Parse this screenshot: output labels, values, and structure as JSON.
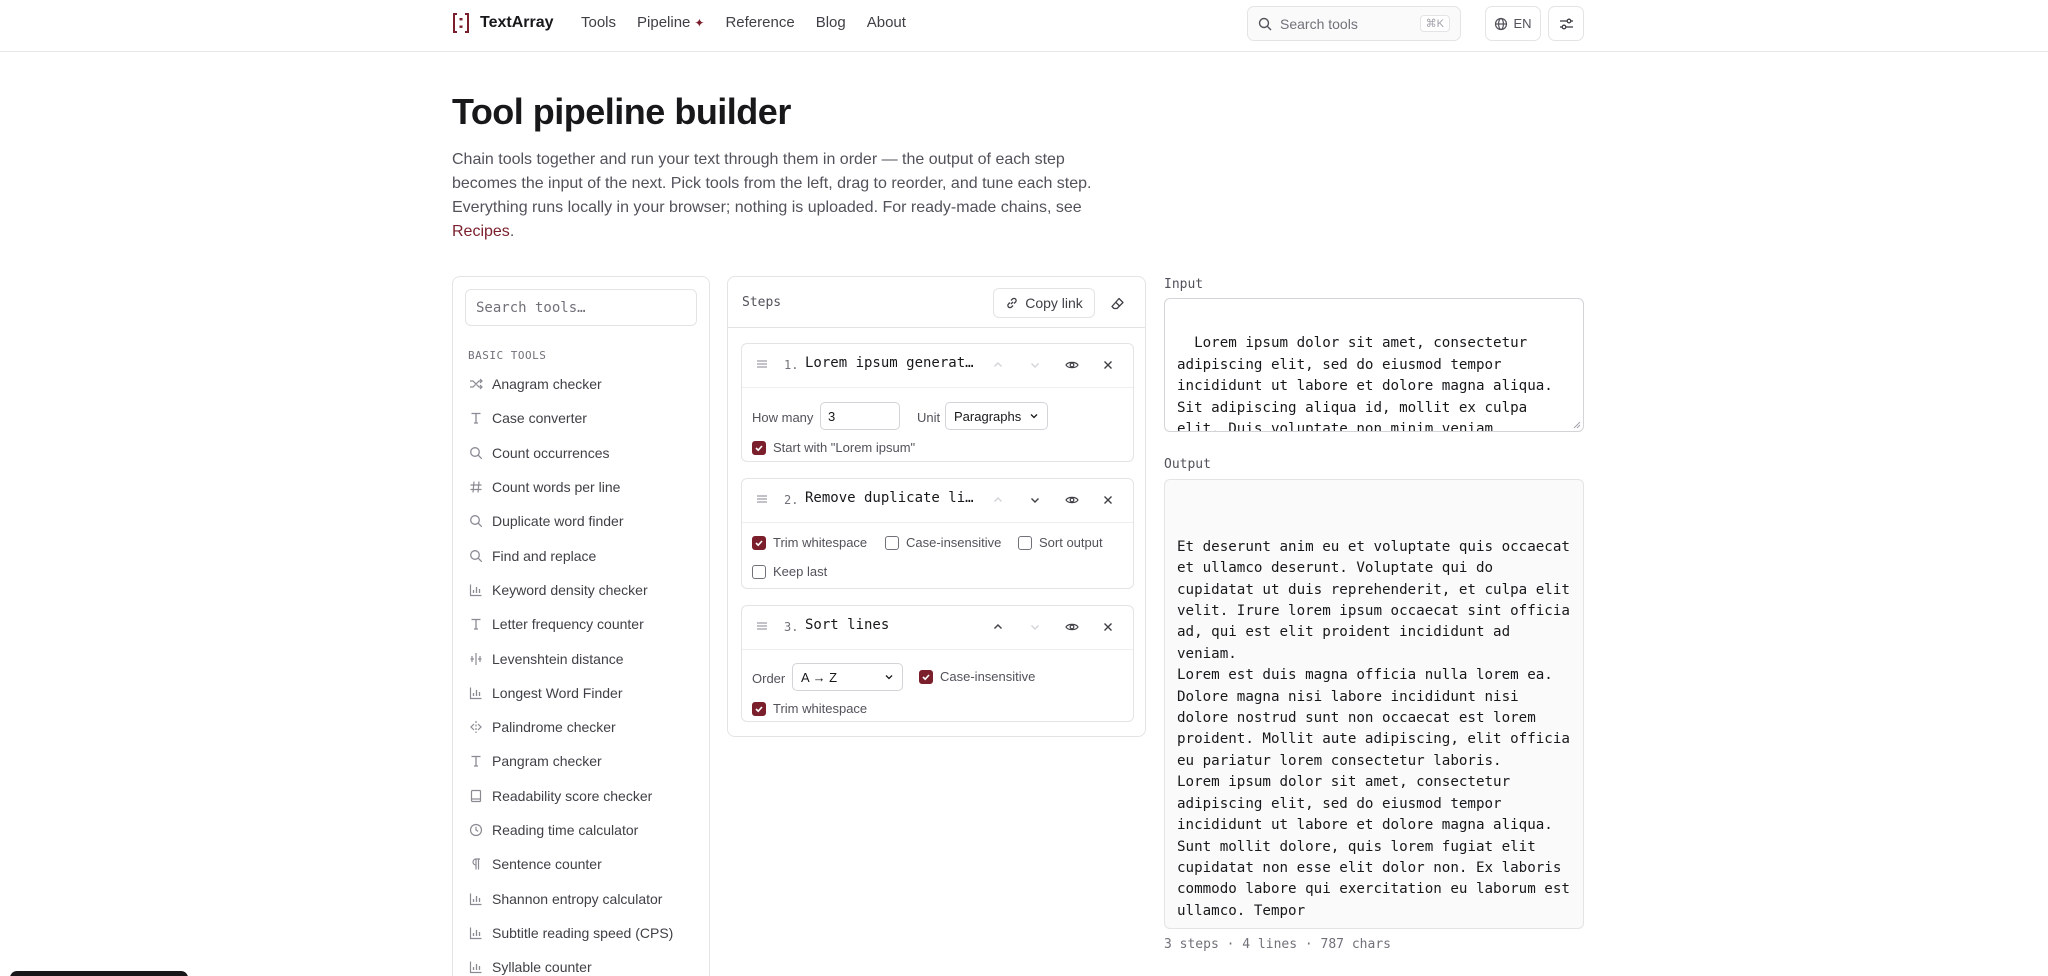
{
  "header": {
    "brand": "TextArray",
    "nav": [
      {
        "label": "Tools"
      },
      {
        "label": "Pipeline"
      },
      {
        "label": "Reference"
      },
      {
        "label": "Blog"
      },
      {
        "label": "About"
      }
    ],
    "search_placeholder": "Search tools",
    "search_shortcut": "⌘K",
    "language": "EN"
  },
  "page": {
    "title": "Tool pipeline builder",
    "intro": "Chain tools together and run your text through them in order — the output of each step becomes the input of the next. Pick tools from the left, drag to reorder, and tune each step. Everything runs locally in your browser; nothing is uploaded. For ready-made chains, see ",
    "intro_link": "Recipes",
    "intro_end": "."
  },
  "tools": {
    "search_placeholder": "Search tools…",
    "group_label": "BASIC TOOLS",
    "items": [
      {
        "label": "Anagram checker",
        "icon": "shuffle-icon"
      },
      {
        "label": "Case converter",
        "icon": "type-icon"
      },
      {
        "label": "Count occurrences",
        "icon": "search-icon"
      },
      {
        "label": "Count words per line",
        "icon": "hash-icon"
      },
      {
        "label": "Duplicate word finder",
        "icon": "search-icon"
      },
      {
        "label": "Find and replace",
        "icon": "search-icon"
      },
      {
        "label": "Keyword density checker",
        "icon": "bar-chart-icon"
      },
      {
        "label": "Letter frequency counter",
        "icon": "type-icon"
      },
      {
        "label": "Levenshtein distance",
        "icon": "diff-icon"
      },
      {
        "label": "Longest Word Finder",
        "icon": "bar-chart-icon"
      },
      {
        "label": "Palindrome checker",
        "icon": "mirror-icon"
      },
      {
        "label": "Pangram checker",
        "icon": "type-icon"
      },
      {
        "label": "Readability score checker",
        "icon": "book-icon"
      },
      {
        "label": "Reading time calculator",
        "icon": "clock-icon"
      },
      {
        "label": "Sentence counter",
        "icon": "pilcrow-icon"
      },
      {
        "label": "Shannon entropy calculator",
        "icon": "bar-chart-icon"
      },
      {
        "label": "Subtitle reading speed (CPS)",
        "icon": "bar-chart-icon"
      },
      {
        "label": "Syllable counter",
        "icon": "bar-chart-icon"
      }
    ]
  },
  "steps": {
    "label": "Steps",
    "copy_link": "Copy link",
    "items": [
      {
        "num": "1.",
        "title": "Lorem ipsum generator",
        "how_many_label": "How many",
        "how_many_value": "3",
        "unit_label": "Unit",
        "unit_value": "Paragraphs",
        "start_label": "Start with \"Lorem ipsum\""
      },
      {
        "num": "2.",
        "title": "Remove duplicate lines",
        "trim_label": "Trim whitespace",
        "case_label": "Case-insensitive",
        "sort_label": "Sort output",
        "keep_label": "Keep last"
      },
      {
        "num": "3.",
        "title": "Sort lines",
        "order_label": "Order",
        "order_value": "A → Z",
        "case_label": "Case-insensitive",
        "trim_label": "Trim whitespace"
      }
    ]
  },
  "io": {
    "input_label": "Input",
    "input_text": "Lorem ipsum dolor sit amet, consectetur adipiscing elit, sed do eiusmod tempor incididunt ut labore et dolore magna aliqua. Sit adipiscing aliqua id, mollit ex culpa elit. Duis voluptate non minim veniam adipiscing elit ea. Enim eiusmod nulla",
    "output_label": "Output",
    "output_text": "\nEt deserunt anim eu et voluptate quis occaecat et ullamco deserunt. Voluptate qui do cupidatat ut duis reprehenderit, et culpa elit velit. Irure lorem ipsum occaecat sint officia ad, qui est elit proident incididunt ad veniam.\nLorem est duis magna officia nulla lorem ea. Dolore magna nisi labore incididunt nisi dolore nostrud sunt non occaecat est lorem proident. Mollit aute adipiscing, elit officia eu pariatur lorem consectetur laboris.\nLorem ipsum dolor sit amet, consectetur adipiscing elit, sed do eiusmod tempor incididunt ut labore et dolore magna aliqua. Sunt mollit dolore, quis lorem fugiat elit cupidatat non esse elit dolor non. Ex laboris commodo labore qui exercitation eu laborum est ullamco. Tempor",
    "stats": "3 steps · 4 lines · 787 chars"
  },
  "colors": {
    "accent": "#7a1f2b",
    "border": "#e4e4e7",
    "text": "#18181b",
    "muted": "#52525b"
  }
}
